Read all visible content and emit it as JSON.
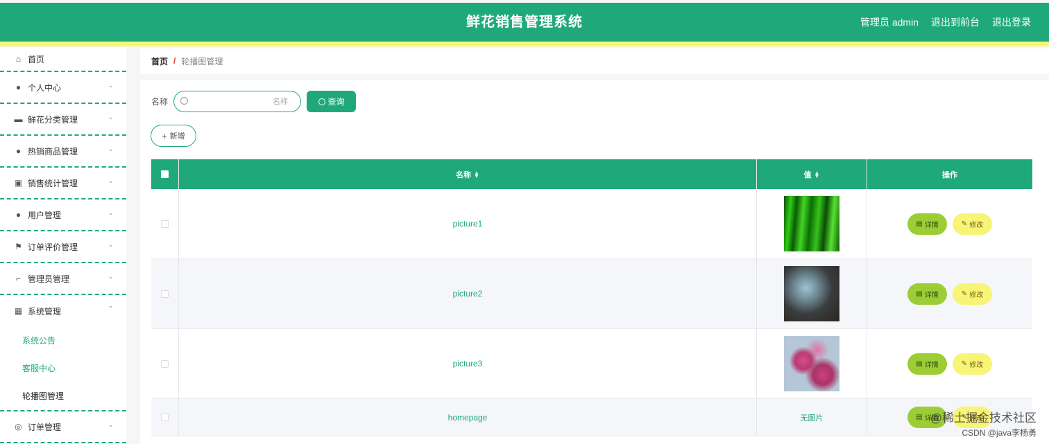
{
  "header": {
    "title": "鲜花销售管理系统",
    "user_label": "管理员 admin",
    "to_front": "退出到前台",
    "logout": "退出登录"
  },
  "sidebar": {
    "items": [
      {
        "label": "首页",
        "icon": "home-icon"
      },
      {
        "label": "个人中心",
        "icon": "user-icon"
      },
      {
        "label": "鲜花分类管理",
        "icon": "chat-icon"
      },
      {
        "label": "热销商品管理",
        "icon": "user-icon"
      },
      {
        "label": "销售统计管理",
        "icon": "briefcase-icon"
      },
      {
        "label": "用户管理",
        "icon": "user-icon"
      },
      {
        "label": "订单评价管理",
        "icon": "flag-icon"
      },
      {
        "label": "管理员管理",
        "icon": "crop-icon"
      },
      {
        "label": "系统管理",
        "icon": "grid-icon"
      },
      {
        "label": "订单管理",
        "icon": "circle-icon"
      }
    ],
    "sub_items": [
      "系统公告",
      "客服中心",
      "轮播图管理"
    ]
  },
  "breadcrumb": {
    "home": "首页",
    "separator": "/",
    "current": "轮播图管理"
  },
  "search": {
    "label": "名称",
    "placeholder": "名称",
    "value": "",
    "query_label": "查询"
  },
  "add_label": "新增",
  "table": {
    "headers": {
      "name": "名称",
      "value": "值",
      "ops": "操作"
    },
    "rows": [
      {
        "name": "picture1",
        "value": "",
        "image": "grass"
      },
      {
        "name": "picture2",
        "value": "",
        "image": "blue-flowers"
      },
      {
        "name": "picture3",
        "value": "",
        "image": "pink-flowers"
      },
      {
        "name": "homepage",
        "value": "无图片",
        "image": ""
      }
    ],
    "detail_label": "详情",
    "edit_label": "修改"
  },
  "watermark": {
    "line1": "@稀土掘金技术社区",
    "line2": "CSDN @java李杨勇"
  },
  "colors": {
    "primary": "#1fa97a",
    "stripe": "#f6f773",
    "detail_btn": "#9ccd34",
    "edit_btn": "#f8f476"
  }
}
